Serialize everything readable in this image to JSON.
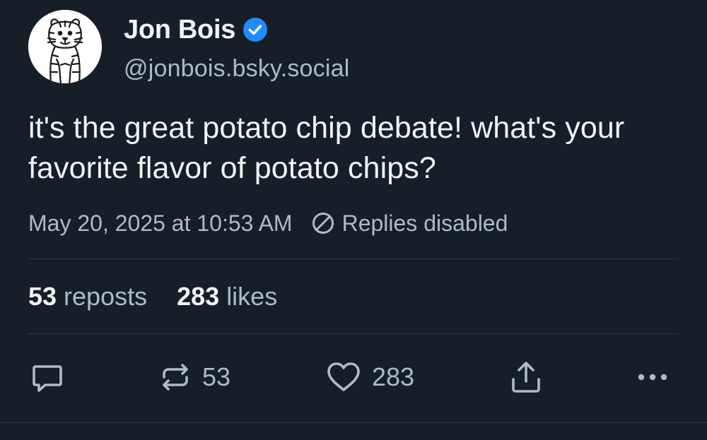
{
  "author": {
    "display_name": "Jon Bois",
    "handle": "@jonbois.bsky.social",
    "verified_icon": "verified-check-icon",
    "avatar": "calvin-and-hobbes-hobbes-drawing"
  },
  "post": {
    "text": "it's the great potato chip debate! what's your favorite flavor of potato chips?",
    "timestamp": "May 20, 2025 at 10:53 AM",
    "replies_status": "Replies disabled"
  },
  "stats": {
    "reposts_count": "53",
    "reposts_label": "reposts",
    "likes_count": "283",
    "likes_label": "likes"
  },
  "actions": {
    "reply_icon": "reply-bubble-icon",
    "repost_icon": "repost-icon",
    "repost_count": "53",
    "like_icon": "heart-icon",
    "like_count": "283",
    "share_icon": "share-icon",
    "more_icon": "more-dots-icon"
  },
  "colors": {
    "background": "#161e27",
    "primary_text": "#f1f3f5",
    "secondary_text": "#aebbc9",
    "divider": "#2e3a48",
    "verified_blue": "#208bfe"
  }
}
